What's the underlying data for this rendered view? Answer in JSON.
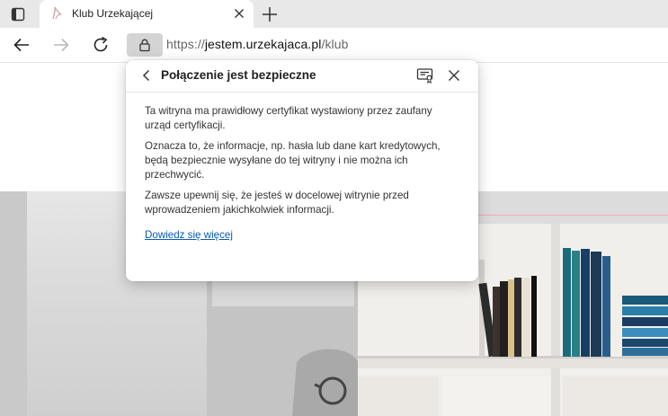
{
  "tab": {
    "title": "Klub Urzekającej"
  },
  "address_bar": {
    "protocol": "https://",
    "host": "jestem.urzekajaca.pl",
    "path": "/klub"
  },
  "security_popup": {
    "title": "Połączenie jest bezpieczne",
    "paragraphs": [
      "Ta witryna ma prawidłowy certyfikat wystawiony przez zaufany urząd certyfikacji.",
      "Oznacza to, że informacje, np. hasła lub dane kart kredytowych, będą bezpiecznie wysyłane do tej witryny i nie można ich przechwycić.",
      "Zawsze upewnij się, że jesteś w docelowej witrynie przed wprowadzeniem jakichkolwiek informacji."
    ],
    "learn_more": "Dowiedz się więcej"
  },
  "colors": {
    "link": "#0a5bb5",
    "lock_button_bg": "#d4d4d4",
    "tabstrip_bg": "#e8e8e8"
  }
}
